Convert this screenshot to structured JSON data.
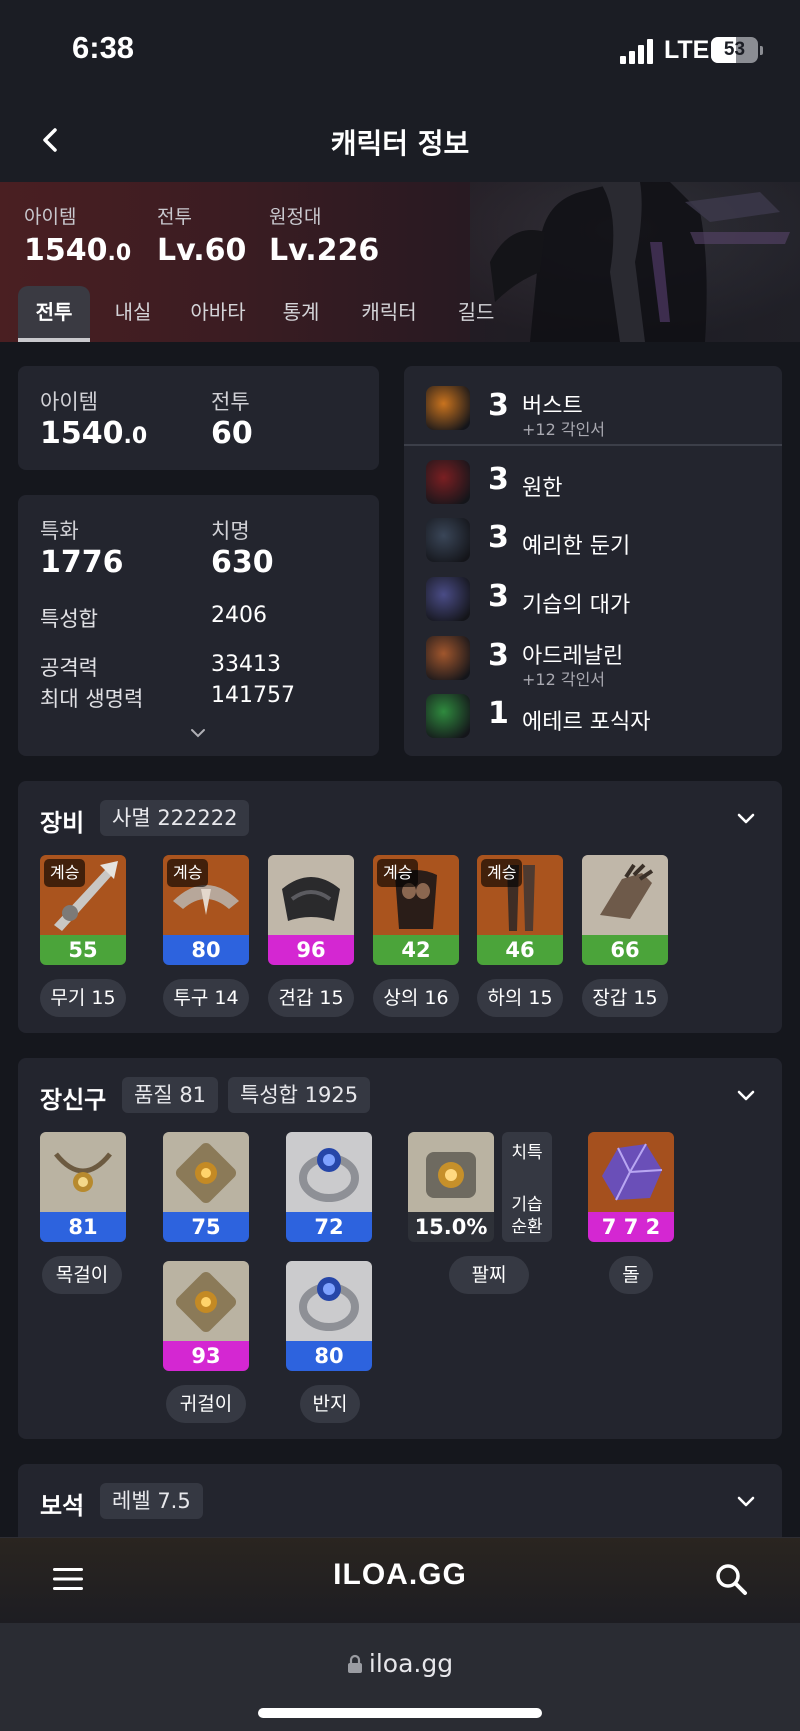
{
  "status_bar": {
    "time": "6:38",
    "network": "LTE",
    "battery": "53",
    "battery_level": 0.53
  },
  "header": {
    "title": "캐릭터 정보"
  },
  "hero": {
    "stats": [
      {
        "label": "아이템",
        "value_main": "1540",
        "value_dec": ".0"
      },
      {
        "label": "전투",
        "value": "Lv.60"
      },
      {
        "label": "원정대",
        "value": "Lv.226"
      }
    ],
    "tabs": [
      "전투",
      "내실",
      "아바타",
      "통계",
      "캐릭터",
      "길드"
    ]
  },
  "summary": {
    "item_label": "아이템",
    "item_main": "1540",
    "item_dec": ".0",
    "combat_label": "전투",
    "combat_value": "60"
  },
  "stats": {
    "spec_label": "특화",
    "spec_value": "1776",
    "crit_label": "치명",
    "crit_value": "630",
    "total_label": "특성합",
    "total_value": "2406",
    "atk_label": "공격력",
    "atk_value": "33413",
    "hp_label": "최대 생명력",
    "hp_value": "141757"
  },
  "engravings": [
    {
      "level": "3",
      "name": "버스트",
      "sub": "+12 각인서",
      "icon": "burst-icon",
      "color": "#c9731e"
    },
    {
      "level": "3",
      "name": "원한",
      "sub": "",
      "icon": "grudge-icon",
      "color": "#7a1f22"
    },
    {
      "level": "3",
      "name": "예리한 둔기",
      "sub": "",
      "icon": "keen-blunt-icon",
      "color": "#3a4658"
    },
    {
      "level": "3",
      "name": "기습의 대가",
      "sub": "",
      "icon": "master-ambush-icon",
      "color": "#4a4c86"
    },
    {
      "level": "3",
      "name": "아드레날린",
      "sub": "+12 각인서",
      "icon": "adrenaline-icon",
      "color": "#a0562d"
    },
    {
      "level": "1",
      "name": "에테르 포식자",
      "sub": "",
      "icon": "ether-predator-icon",
      "color": "#2f8a3e"
    }
  ],
  "equipment": {
    "title": "장비",
    "set_chip": "사멸 222222",
    "items": [
      {
        "name": "무기 15",
        "quality": "55",
        "tier": "green",
        "inherit": "계승",
        "art": "weapon-icon"
      },
      {
        "name": "투구 14",
        "quality": "80",
        "tier": "blue",
        "inherit": "계승",
        "art": "helmet-icon"
      },
      {
        "name": "견갑 15",
        "quality": "96",
        "tier": "pink",
        "inherit": "",
        "art": "shoulder-icon"
      },
      {
        "name": "상의 16",
        "quality": "42",
        "tier": "green",
        "inherit": "계승",
        "art": "chest-icon"
      },
      {
        "name": "하의 15",
        "quality": "46",
        "tier": "green",
        "inherit": "계승",
        "art": "pants-icon"
      },
      {
        "name": "장갑 15",
        "quality": "66",
        "tier": "green",
        "inherit": "",
        "art": "gloves-icon"
      }
    ]
  },
  "accessories": {
    "title": "장신구",
    "quality_chip": "품질 81",
    "total_chip": "특성합 1925",
    "necklace": {
      "name": "목걸이",
      "quality": "81"
    },
    "earring1": {
      "quality": "75"
    },
    "ring1": {
      "quality": "72"
    },
    "earring2": {
      "name": "귀걸이",
      "quality": "93"
    },
    "ring2": {
      "name": "반지",
      "quality": "80"
    },
    "bracelet": {
      "name": "팔찌",
      "percent": "15.0%",
      "effect1": "치특",
      "effect2a": "기습",
      "effect2b": "순환"
    },
    "stone": {
      "name": "돌",
      "value": "7 7 2"
    }
  },
  "gems": {
    "title": "보석",
    "level_chip": "레벨 7.5"
  },
  "bottom": {
    "logo": "ILOA.GG",
    "url": "iloa.gg"
  }
}
